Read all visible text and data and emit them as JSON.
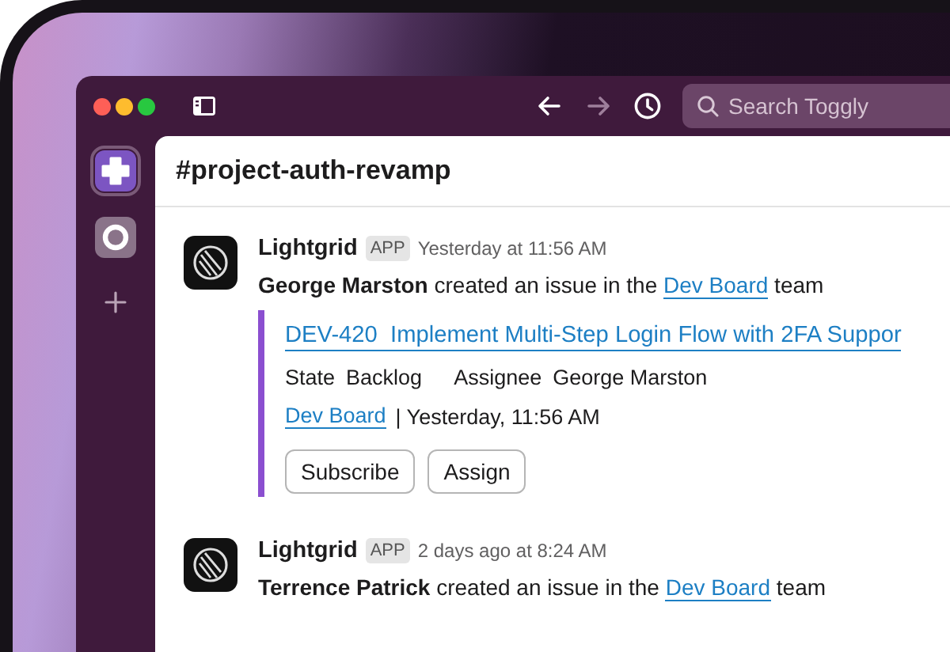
{
  "window": {
    "nav": [
      {
        "kind": "back",
        "disabled": false
      },
      {
        "kind": "forward",
        "disabled": true
      },
      {
        "kind": "history",
        "disabled": false
      }
    ],
    "search": {
      "placeholder": "Search Toggly"
    }
  },
  "sidebar": {
    "workspaces": [
      {
        "kind": "cross",
        "selected": true
      },
      {
        "kind": "ring",
        "selected": false
      }
    ]
  },
  "channel": {
    "title": "#project-auth-revamp"
  },
  "messages": [
    {
      "sender": "Lightgrid",
      "badge": "APP",
      "time": "Yesterday at 11:56 AM",
      "author": "George Marston",
      "action": "created an issue in the",
      "link": "Dev Board",
      "suffix": "team",
      "attachment": {
        "title": "DEV-420  Implement Multi-Step Login Flow with 2FA Suppor",
        "fields": [
          {
            "label": "State",
            "value": "Backlog"
          },
          {
            "label": "Assignee",
            "value": "George Marston"
          }
        ],
        "footer_link": "Dev Board",
        "footer_text": "| Yesterday, 11:56 AM",
        "buttons": [
          "Subscribe",
          "Assign"
        ]
      }
    },
    {
      "sender": "Lightgrid",
      "badge": "APP",
      "time": "2 days ago at 8:24 AM",
      "author": "Terrence Patrick",
      "action": "created an issue in the",
      "link": "Dev Board",
      "suffix": "team"
    }
  ]
}
